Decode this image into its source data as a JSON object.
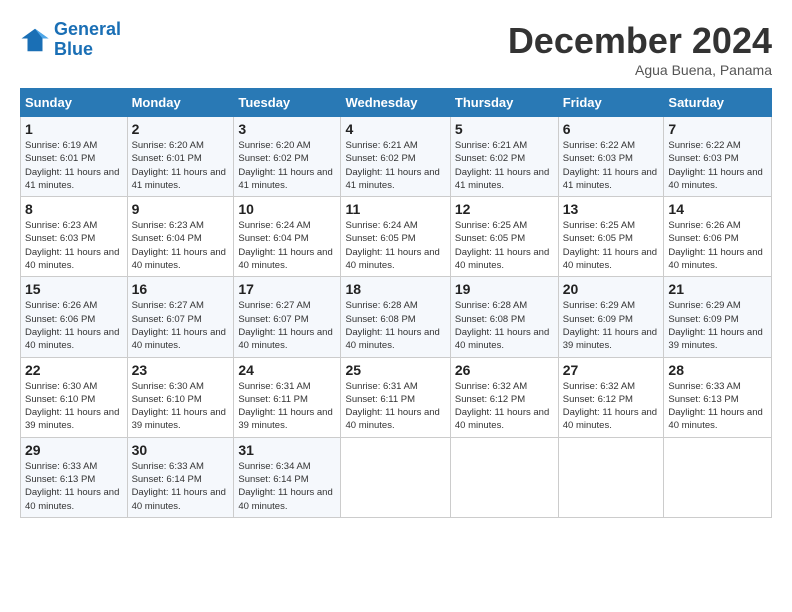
{
  "header": {
    "logo_line1": "General",
    "logo_line2": "Blue",
    "month": "December 2024",
    "location": "Agua Buena, Panama"
  },
  "days_of_week": [
    "Sunday",
    "Monday",
    "Tuesday",
    "Wednesday",
    "Thursday",
    "Friday",
    "Saturday"
  ],
  "weeks": [
    [
      {
        "day": 1,
        "sunrise": "6:19 AM",
        "sunset": "6:01 PM",
        "daylight": "11 hours and 41 minutes."
      },
      {
        "day": 2,
        "sunrise": "6:20 AM",
        "sunset": "6:01 PM",
        "daylight": "11 hours and 41 minutes."
      },
      {
        "day": 3,
        "sunrise": "6:20 AM",
        "sunset": "6:02 PM",
        "daylight": "11 hours and 41 minutes."
      },
      {
        "day": 4,
        "sunrise": "6:21 AM",
        "sunset": "6:02 PM",
        "daylight": "11 hours and 41 minutes."
      },
      {
        "day": 5,
        "sunrise": "6:21 AM",
        "sunset": "6:02 PM",
        "daylight": "11 hours and 41 minutes."
      },
      {
        "day": 6,
        "sunrise": "6:22 AM",
        "sunset": "6:03 PM",
        "daylight": "11 hours and 41 minutes."
      },
      {
        "day": 7,
        "sunrise": "6:22 AM",
        "sunset": "6:03 PM",
        "daylight": "11 hours and 40 minutes."
      }
    ],
    [
      {
        "day": 8,
        "sunrise": "6:23 AM",
        "sunset": "6:03 PM",
        "daylight": "11 hours and 40 minutes."
      },
      {
        "day": 9,
        "sunrise": "6:23 AM",
        "sunset": "6:04 PM",
        "daylight": "11 hours and 40 minutes."
      },
      {
        "day": 10,
        "sunrise": "6:24 AM",
        "sunset": "6:04 PM",
        "daylight": "11 hours and 40 minutes."
      },
      {
        "day": 11,
        "sunrise": "6:24 AM",
        "sunset": "6:05 PM",
        "daylight": "11 hours and 40 minutes."
      },
      {
        "day": 12,
        "sunrise": "6:25 AM",
        "sunset": "6:05 PM",
        "daylight": "11 hours and 40 minutes."
      },
      {
        "day": 13,
        "sunrise": "6:25 AM",
        "sunset": "6:05 PM",
        "daylight": "11 hours and 40 minutes."
      },
      {
        "day": 14,
        "sunrise": "6:26 AM",
        "sunset": "6:06 PM",
        "daylight": "11 hours and 40 minutes."
      }
    ],
    [
      {
        "day": 15,
        "sunrise": "6:26 AM",
        "sunset": "6:06 PM",
        "daylight": "11 hours and 40 minutes."
      },
      {
        "day": 16,
        "sunrise": "6:27 AM",
        "sunset": "6:07 PM",
        "daylight": "11 hours and 40 minutes."
      },
      {
        "day": 17,
        "sunrise": "6:27 AM",
        "sunset": "6:07 PM",
        "daylight": "11 hours and 40 minutes."
      },
      {
        "day": 18,
        "sunrise": "6:28 AM",
        "sunset": "6:08 PM",
        "daylight": "11 hours and 40 minutes."
      },
      {
        "day": 19,
        "sunrise": "6:28 AM",
        "sunset": "6:08 PM",
        "daylight": "11 hours and 40 minutes."
      },
      {
        "day": 20,
        "sunrise": "6:29 AM",
        "sunset": "6:09 PM",
        "daylight": "11 hours and 39 minutes."
      },
      {
        "day": 21,
        "sunrise": "6:29 AM",
        "sunset": "6:09 PM",
        "daylight": "11 hours and 39 minutes."
      }
    ],
    [
      {
        "day": 22,
        "sunrise": "6:30 AM",
        "sunset": "6:10 PM",
        "daylight": "11 hours and 39 minutes."
      },
      {
        "day": 23,
        "sunrise": "6:30 AM",
        "sunset": "6:10 PM",
        "daylight": "11 hours and 39 minutes."
      },
      {
        "day": 24,
        "sunrise": "6:31 AM",
        "sunset": "6:11 PM",
        "daylight": "11 hours and 39 minutes."
      },
      {
        "day": 25,
        "sunrise": "6:31 AM",
        "sunset": "6:11 PM",
        "daylight": "11 hours and 40 minutes."
      },
      {
        "day": 26,
        "sunrise": "6:32 AM",
        "sunset": "6:12 PM",
        "daylight": "11 hours and 40 minutes."
      },
      {
        "day": 27,
        "sunrise": "6:32 AM",
        "sunset": "6:12 PM",
        "daylight": "11 hours and 40 minutes."
      },
      {
        "day": 28,
        "sunrise": "6:33 AM",
        "sunset": "6:13 PM",
        "daylight": "11 hours and 40 minutes."
      }
    ],
    [
      {
        "day": 29,
        "sunrise": "6:33 AM",
        "sunset": "6:13 PM",
        "daylight": "11 hours and 40 minutes."
      },
      {
        "day": 30,
        "sunrise": "6:33 AM",
        "sunset": "6:14 PM",
        "daylight": "11 hours and 40 minutes."
      },
      {
        "day": 31,
        "sunrise": "6:34 AM",
        "sunset": "6:14 PM",
        "daylight": "11 hours and 40 minutes."
      },
      null,
      null,
      null,
      null
    ]
  ]
}
